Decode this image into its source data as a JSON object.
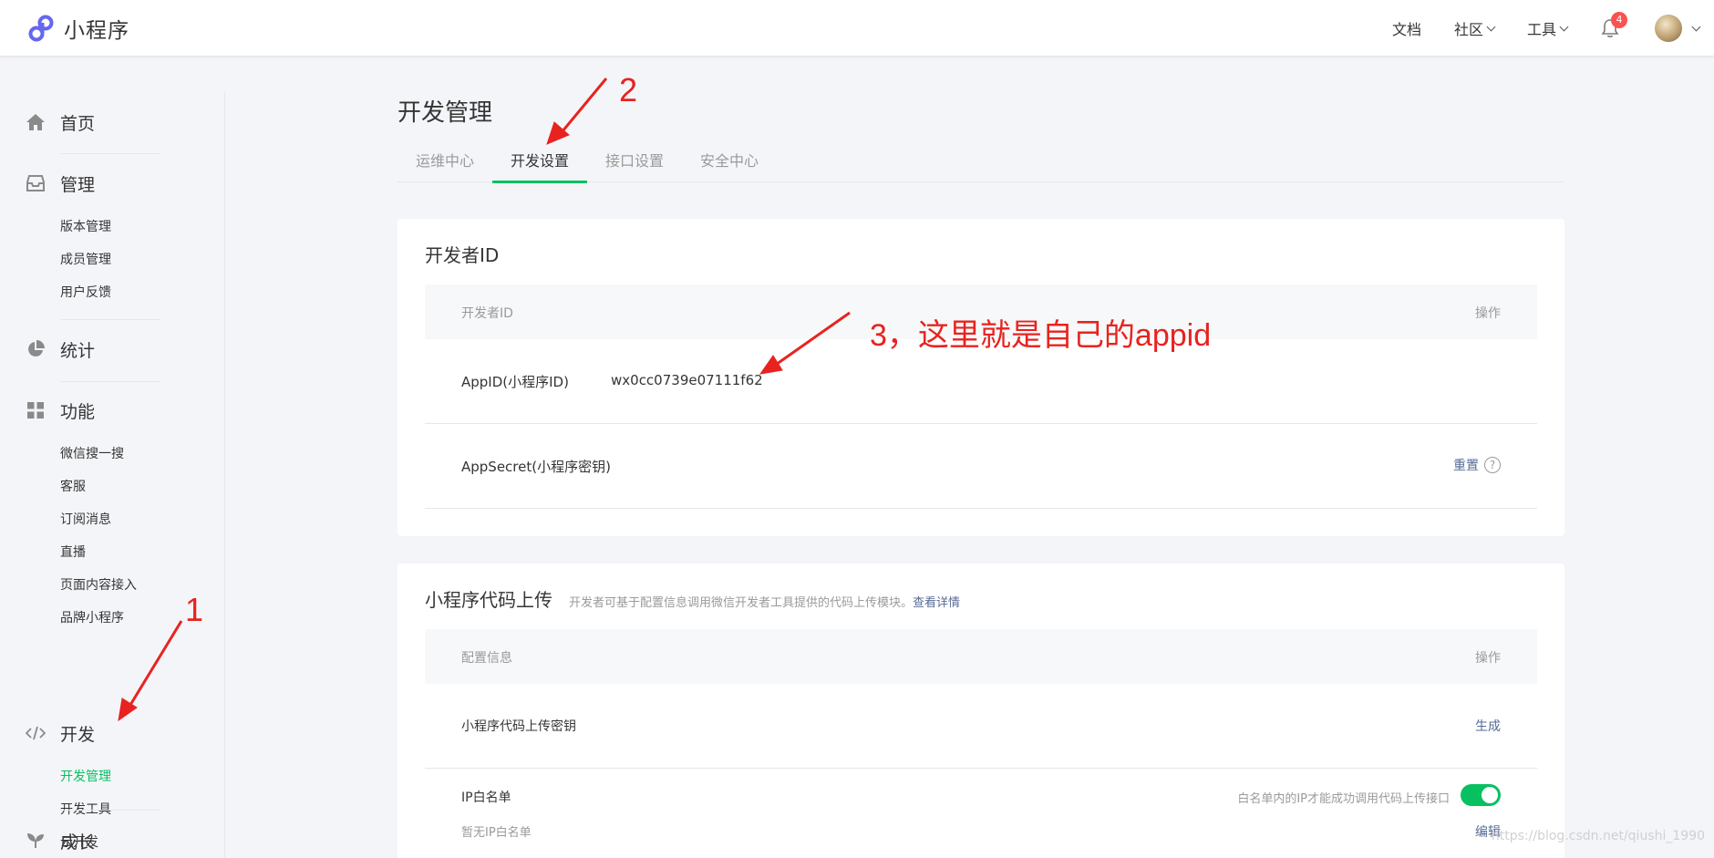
{
  "app": {
    "name": "小程序"
  },
  "topnav": {
    "docs": "文档",
    "community": "社区",
    "tools": "工具",
    "notification_count": "4"
  },
  "sidebar": {
    "home": "首页",
    "manage": {
      "label": "管理",
      "items": [
        "版本管理",
        "成员管理",
        "用户反馈"
      ]
    },
    "stats": "统计",
    "features": {
      "label": "功能",
      "items": [
        "微信搜一搜",
        "客服",
        "订阅消息",
        "直播",
        "页面内容接入",
        "品牌小程序"
      ]
    },
    "dev": {
      "label": "开发",
      "items": [
        "开发管理",
        "开发工具",
        "云开发"
      ]
    },
    "growth": "成长"
  },
  "main": {
    "title": "开发管理",
    "tabs": [
      "运维中心",
      "开发设置",
      "接口设置",
      "安全中心"
    ],
    "developer_id": {
      "title": "开发者ID",
      "col_left": "开发者ID",
      "col_right": "操作",
      "appid_label": "AppID(小程序ID)",
      "appid_value": "wx0cc0739e07111f62",
      "secret_label": "AppSecret(小程序密钥)",
      "secret_action": "重置",
      "help": "?"
    },
    "upload": {
      "title": "小程序代码上传",
      "desc": "开发者可基于配置信息调用微信开发者工具提供的代码上传模块。",
      "desc_link": "查看详情",
      "col_left": "配置信息",
      "col_right": "操作",
      "key_label": "小程序代码上传密钥",
      "key_action": "生成",
      "ip_label": "IP白名单",
      "ip_hint": "白名单内的IP才能成功调用代码上传接口",
      "ip_empty": "暂无IP白名单",
      "ip_action": "编辑",
      "ip_toggle_on": true
    }
  },
  "annotations": {
    "a1": "1",
    "a2": "2",
    "a3": "3，这里就是自己的appid"
  },
  "watermark": "https://blog.csdn.net/qiushi_1990",
  "colors": {
    "accent": "#07c160",
    "link": "#576b95",
    "annotation": "#e8231f",
    "badge": "#fa5151"
  }
}
